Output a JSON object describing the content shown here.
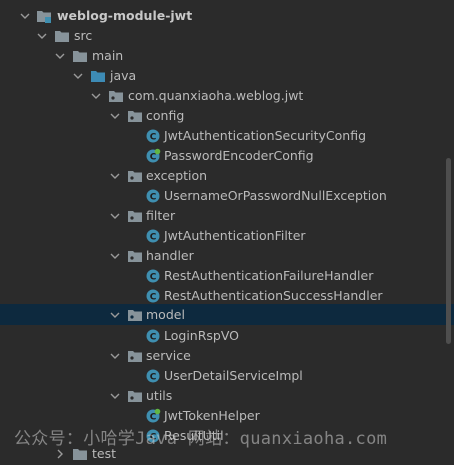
{
  "colors": {
    "background": "#2b2b2b",
    "selection": "#0d293e",
    "folder_blue": "#87939a",
    "class_circle": "#3f8fb0",
    "spring_leaf": "#62b543"
  },
  "tree": {
    "nodes": [
      {
        "label": "weblog-module-jwt",
        "type": "module",
        "expanded": true,
        "selected": false,
        "bold": true
      },
      {
        "label": "src",
        "type": "folder",
        "expanded": true,
        "selected": false
      },
      {
        "label": "main",
        "type": "folder",
        "expanded": true,
        "selected": false
      },
      {
        "label": "java",
        "type": "source-root",
        "expanded": true,
        "selected": false
      },
      {
        "label": "com.quanxiaoha.weblog.jwt",
        "type": "package",
        "expanded": true,
        "selected": false
      },
      {
        "label": "config",
        "type": "package",
        "expanded": true,
        "selected": false
      },
      {
        "label": "JwtAuthenticationSecurityConfig",
        "type": "class",
        "selected": false
      },
      {
        "label": "PasswordEncoderConfig",
        "type": "spring-class",
        "selected": false
      },
      {
        "label": "exception",
        "type": "package",
        "expanded": true,
        "selected": false
      },
      {
        "label": "UsernameOrPasswordNullException",
        "type": "class",
        "selected": false
      },
      {
        "label": "filter",
        "type": "package",
        "expanded": true,
        "selected": false
      },
      {
        "label": "JwtAuthenticationFilter",
        "type": "class",
        "selected": false
      },
      {
        "label": "handler",
        "type": "package",
        "expanded": true,
        "selected": false
      },
      {
        "label": "RestAuthenticationFailureHandler",
        "type": "class",
        "selected": false
      },
      {
        "label": "RestAuthenticationSuccessHandler",
        "type": "class",
        "selected": false
      },
      {
        "label": "model",
        "type": "package",
        "expanded": true,
        "selected": true
      },
      {
        "label": "LoginRspVO",
        "type": "class",
        "selected": false
      },
      {
        "label": "service",
        "type": "package",
        "expanded": true,
        "selected": false
      },
      {
        "label": "UserDetailServiceImpl",
        "type": "class",
        "selected": false
      },
      {
        "label": "utils",
        "type": "package",
        "expanded": true,
        "selected": false
      },
      {
        "label": "JwtTokenHelper",
        "type": "spring-class",
        "selected": false
      },
      {
        "label": "ResultUtil",
        "type": "class",
        "selected": false
      },
      {
        "label": "test",
        "type": "folder",
        "expanded": false,
        "selected": false
      }
    ]
  },
  "watermark": {
    "text": "公众号：小哈学Java  网站：quanxiaoha.com"
  }
}
